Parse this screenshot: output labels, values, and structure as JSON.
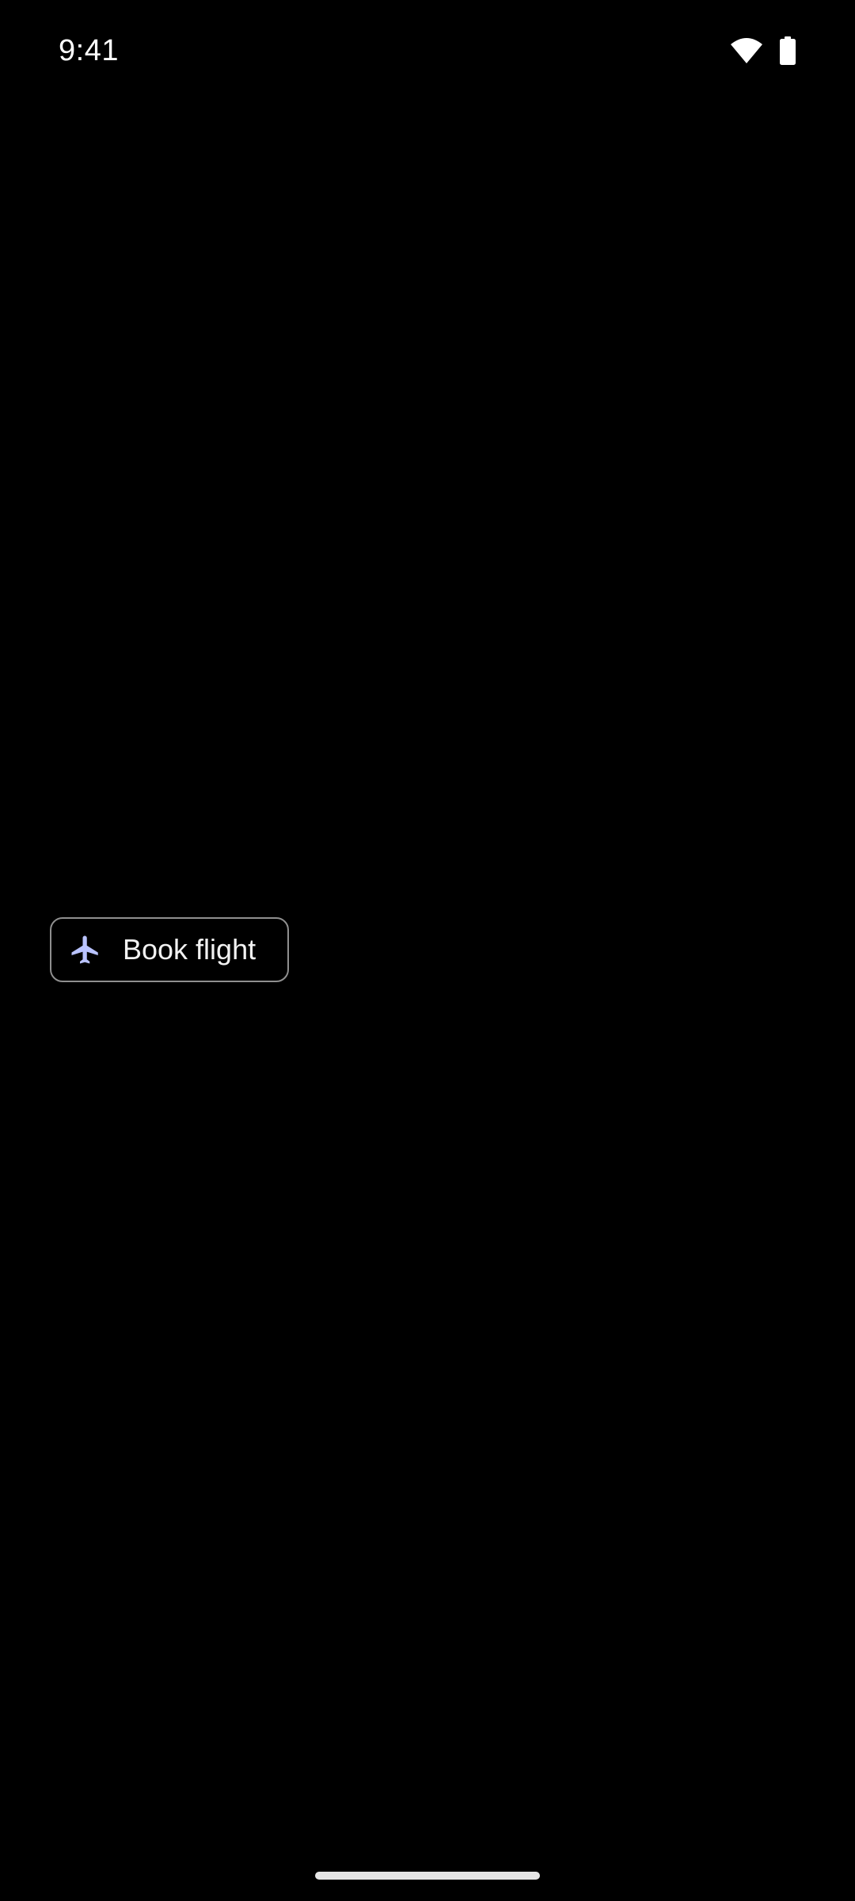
{
  "status_bar": {
    "time": "9:41",
    "icons": [
      "wifi-icon",
      "battery-icon"
    ]
  },
  "chip": {
    "label": "Book flight",
    "icon": "airplane-icon",
    "icon_color": "#b9c3ff",
    "border_color": "#8f8f8f"
  },
  "theme": {
    "background": "#000000",
    "text": "#ffffff"
  }
}
